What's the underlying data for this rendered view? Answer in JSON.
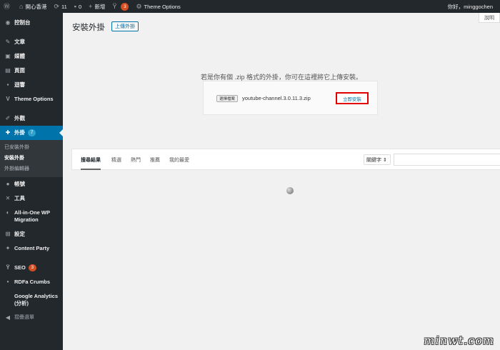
{
  "adminbar": {
    "site_name": "開心香港",
    "updates_count": "11",
    "comments_count": "0",
    "new_label": "新增",
    "seo_badge": "3",
    "theme_options": "Theme Options",
    "greeting": "你好，minggochen"
  },
  "sidebar": {
    "dashboard": "控制台",
    "posts": "文章",
    "media": "媒體",
    "pages": "頁面",
    "comments": "迴響",
    "theme_options": "Theme Options",
    "appearance": "外觀",
    "plugins": "外掛",
    "plugins_badge": "7",
    "submenu": [
      "已安裝外掛",
      "安裝外掛",
      "外掛編輯器"
    ],
    "users": "帳號",
    "tools": "工具",
    "migration": "All-in-One WP Migration",
    "settings": "設定",
    "content_party": "Content Party",
    "seo": "SEO",
    "seo_badge": "3",
    "rdfa": "RDFa Crumbs",
    "google_analytics": "Google Analytics (分析)",
    "collapse": "摺疊選單"
  },
  "main": {
    "help_tab": "說明",
    "title": "安裝外掛",
    "upload_button": "上傳外掛",
    "upload_desc": "若是你有個 .zip 格式的外掛，你可在這裡將它上傳安裝。",
    "choose_file": "選擇檔案",
    "filename": "youtube-channel.3.0.11.3.zip",
    "install_now": "立即安裝",
    "tabs": [
      "搜尋結果",
      "精選",
      "熱門",
      "推薦",
      "我的最愛"
    ],
    "search_type": "關鍵字 ⇕"
  },
  "watermark": "minwt.com"
}
